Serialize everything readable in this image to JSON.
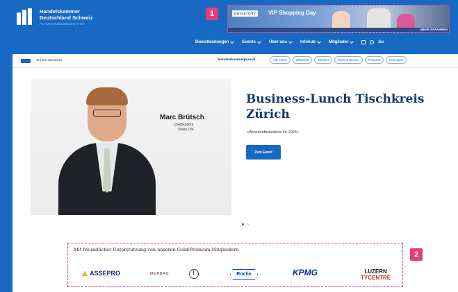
{
  "header": {
    "logo_line1": "Handelskammer",
    "logo_line2": "Deutschland Schweiz",
    "logo_tagline": "Für Wirtschaftsnetzwerk D-CH"
  },
  "ad": {
    "badge": "1",
    "brand": "OUTLETCITY",
    "title": "VIP Shopping Day",
    "cta": "MEHR ERFAHREN"
  },
  "nav": {
    "items": [
      {
        "label": "Dienstleistungen"
      },
      {
        "label": "Events"
      },
      {
        "label": "Über uns"
      },
      {
        "label": "Infohub"
      },
      {
        "label": "Mitglieder"
      }
    ],
    "search_label": "Su"
  },
  "subbar": {
    "left_text": "Teil des Netzwerks",
    "journal": "Handelskammerjournal",
    "chips": [
      "Alle Artikel",
      "Wirtschaft",
      "Standort",
      "Recht & Steuern",
      "Finanzen",
      "Firmenport"
    ]
  },
  "hero": {
    "person_name": "Marc Brütsch",
    "person_role1": "Chefökonom",
    "person_role2": "Swiss Life",
    "title_line1": "Business-Lunch Tischkreis",
    "title_line2": "Zürich",
    "subtitle": "«Wirtschaftsausblick für 2026»",
    "button": "Zum Event"
  },
  "sponsors": {
    "badge": "2",
    "heading": "Mit freundlicher Unterstützung von unseren Gold/Premium Mitgliedern",
    "logos": {
      "assepro": "ASSEPRO",
      "merbag": "MERBAG",
      "roche": "Roche",
      "kpmg": "KPMG",
      "luzern_top": "LUZERN",
      "luzern_bottom": "TYCENTRE"
    }
  },
  "colors": {
    "brand_blue": "#1769c4",
    "highlight_pink": "#e93a7d",
    "title_navy": "#123a6b"
  }
}
